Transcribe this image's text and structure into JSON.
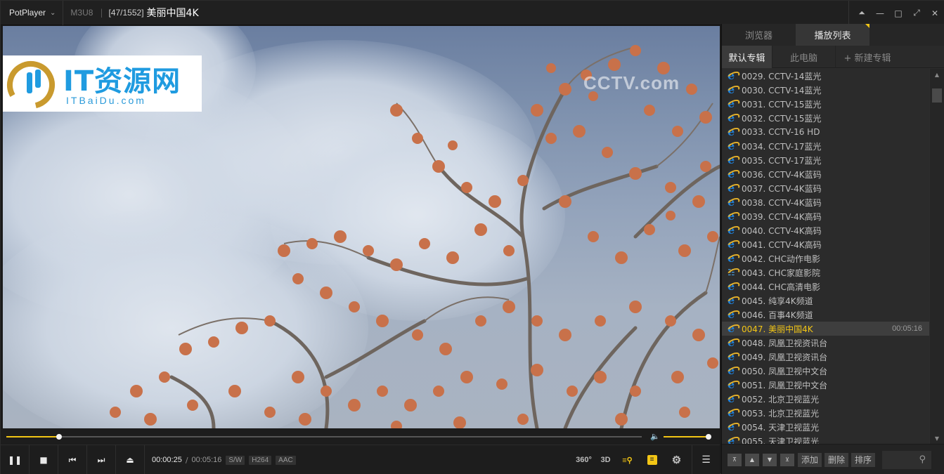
{
  "titlebar": {
    "app_name": "PotPlayer",
    "format": "M3U8",
    "separator": "|",
    "count": "[47/1552]",
    "title": "美丽中国4K",
    "controls": [
      "pin-icon",
      "minimize-icon",
      "maximize-icon",
      "fullscreen-icon",
      "close-icon"
    ]
  },
  "video": {
    "channel_logo": "CCTV.com",
    "watermark_title": "IT资源网",
    "watermark_sub": "ITBaiDu.com"
  },
  "seek": {
    "position": 0.083,
    "volume": 1.0
  },
  "controls": {
    "current_time": "00:00:25",
    "time_sep": "/",
    "total_time": "00:05:16",
    "badges": [
      "S/W",
      "H264",
      "AAC"
    ],
    "right": {
      "vr": "360°",
      "three_d": "3D"
    }
  },
  "panel": {
    "tabs": [
      {
        "label": "浏览器",
        "active": false
      },
      {
        "label": "播放列表",
        "active": true
      }
    ],
    "subtabs": [
      {
        "label": "默认专辑",
        "active": true
      },
      {
        "label": "此电脑",
        "active": false
      },
      {
        "label": "+ 新建专辑",
        "active": false
      }
    ],
    "items": [
      {
        "label": "0029. CCTV-14蓝光"
      },
      {
        "label": "0030. CCTV-14蓝光"
      },
      {
        "label": "0031. CCTV-15蓝光"
      },
      {
        "label": "0032. CCTV-15蓝光"
      },
      {
        "label": "0033. CCTV-16 HD"
      },
      {
        "label": "0034. CCTV-17蓝光"
      },
      {
        "label": "0035. CCTV-17蓝光"
      },
      {
        "label": "0036. CCTV-4K蓝码"
      },
      {
        "label": "0037. CCTV-4K蓝码"
      },
      {
        "label": "0038. CCTV-4K蓝码"
      },
      {
        "label": "0039. CCTV-4K高码"
      },
      {
        "label": "0040. CCTV-4K高码"
      },
      {
        "label": "0041. CCTV-4K高码"
      },
      {
        "label": "0042. CHC动作电影"
      },
      {
        "label": "0043. CHC家庭影院",
        "icon": "network-icon"
      },
      {
        "label": "0044. CHC高清电影"
      },
      {
        "label": "0045. 纯享4K频道"
      },
      {
        "label": "0046. 百事4K频道"
      },
      {
        "label": "0047. 美丽中国4K",
        "current": true,
        "duration": "00:05:16"
      },
      {
        "label": "0048. 凤凰卫视资讯台"
      },
      {
        "label": "0049. 凤凰卫视资讯台"
      },
      {
        "label": "0050. 凤凰卫视中文台"
      },
      {
        "label": "0051. 凤凰卫视中文台"
      },
      {
        "label": "0052. 北京卫视蓝光"
      },
      {
        "label": "0053. 北京卫视蓝光"
      },
      {
        "label": "0054. 天津卫视蓝光"
      },
      {
        "label": "0055. 天津卫视蓝光"
      }
    ],
    "bottom": {
      "add": "添加",
      "delete": "删除",
      "sort": "排序"
    }
  },
  "colors": {
    "accent": "#f2c515",
    "panel_bg": "#2d2d2d",
    "title_bg": "#202020"
  }
}
